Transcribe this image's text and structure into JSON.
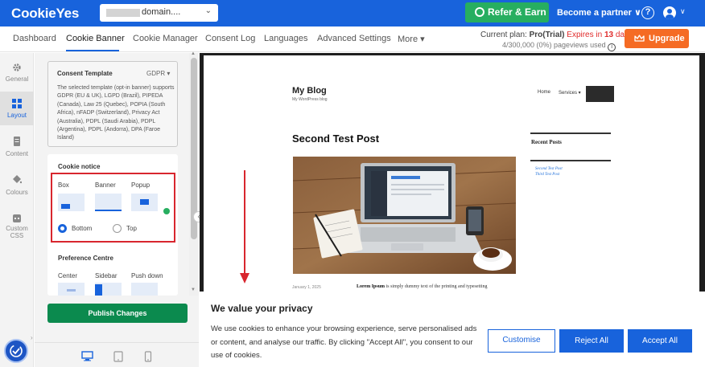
{
  "header": {
    "logo": "CookieYes",
    "domain": "domain....",
    "refer_label": "Refer & Earn",
    "partner_label": "Become a partner ∨",
    "help_glyph": "?"
  },
  "nav": {
    "tabs": [
      {
        "label": "Dashboard"
      },
      {
        "label": "Cookie Banner"
      },
      {
        "label": "Cookie Manager"
      },
      {
        "label": "Consent Log"
      },
      {
        "label": "Languages"
      },
      {
        "label": "Advanced Settings"
      },
      {
        "label": "More ▾"
      }
    ],
    "plan_prefix": "Current plan: ",
    "plan_name": "Pro(Trial)",
    "plan_expiry_prefix": " Expires in ",
    "plan_days": "13",
    "plan_days_suffix": " days",
    "pageviews": "4/300,000 (0%) pageviews used",
    "upgrade_label": "Upgrade"
  },
  "rail": {
    "items": [
      {
        "label": "General"
      },
      {
        "label": "Layout"
      },
      {
        "label": "Content"
      },
      {
        "label": "Colours"
      },
      {
        "label": "Custom CSS"
      }
    ]
  },
  "template_card": {
    "title": "Consent Template",
    "selected": "GDPR ▾",
    "description": "The selected template (opt-in banner) supports GDPR (EU & UK), LGPD (Brazil), PIPEDA (Canada), Law 25 (Quebec), POPIA (South Africa), nFADP (Switzerland), Privacy Act (Australia), PDPL (Saudi Arabia), PDPL (Argentina), PDPL (Andorra), DPA (Faroe Island)"
  },
  "cookie_notice": {
    "title": "Cookie notice",
    "layouts": [
      {
        "label": "Box"
      },
      {
        "label": "Banner"
      },
      {
        "label": "Popup"
      }
    ],
    "selected_layout": "Banner",
    "positions": [
      {
        "label": "Bottom"
      },
      {
        "label": "Top"
      }
    ],
    "selected_position": "Bottom"
  },
  "preference_centre": {
    "title": "Preference Centre",
    "layouts": [
      {
        "label": "Center"
      },
      {
        "label": "Sidebar"
      },
      {
        "label": "Push down"
      }
    ]
  },
  "publish_label": "Publish Changes",
  "preview": {
    "blog_title": "My Blog",
    "blog_tagline": "My WordPress blog",
    "menu_home": "Home",
    "menu_services": "Services ▾",
    "post_title": "Second Test Post",
    "recent_title": "Recent Posts",
    "recent_posts": [
      "Second Test Post",
      "Third Test Post"
    ],
    "post_date": "January 1, 2025",
    "lorem_bold": "Lorem Ipsum",
    "lorem_rest": " is simply dummy text of the printing and typesetting"
  },
  "banner": {
    "title": "We value your privacy",
    "text": "We use cookies to enhance your browsing experience, serve personalised ads or content, and analyse our traffic. By clicking \"Accept All\", you consent to our use of cookies.",
    "customise": "Customise",
    "reject": "Reject All",
    "accept": "Accept All"
  },
  "colors": {
    "brand_blue": "#1863dc",
    "refer_green": "#27ae60",
    "upgrade_orange": "#f56b24",
    "publish_green": "#0b8a4e",
    "highlight_red": "#d8262e"
  }
}
